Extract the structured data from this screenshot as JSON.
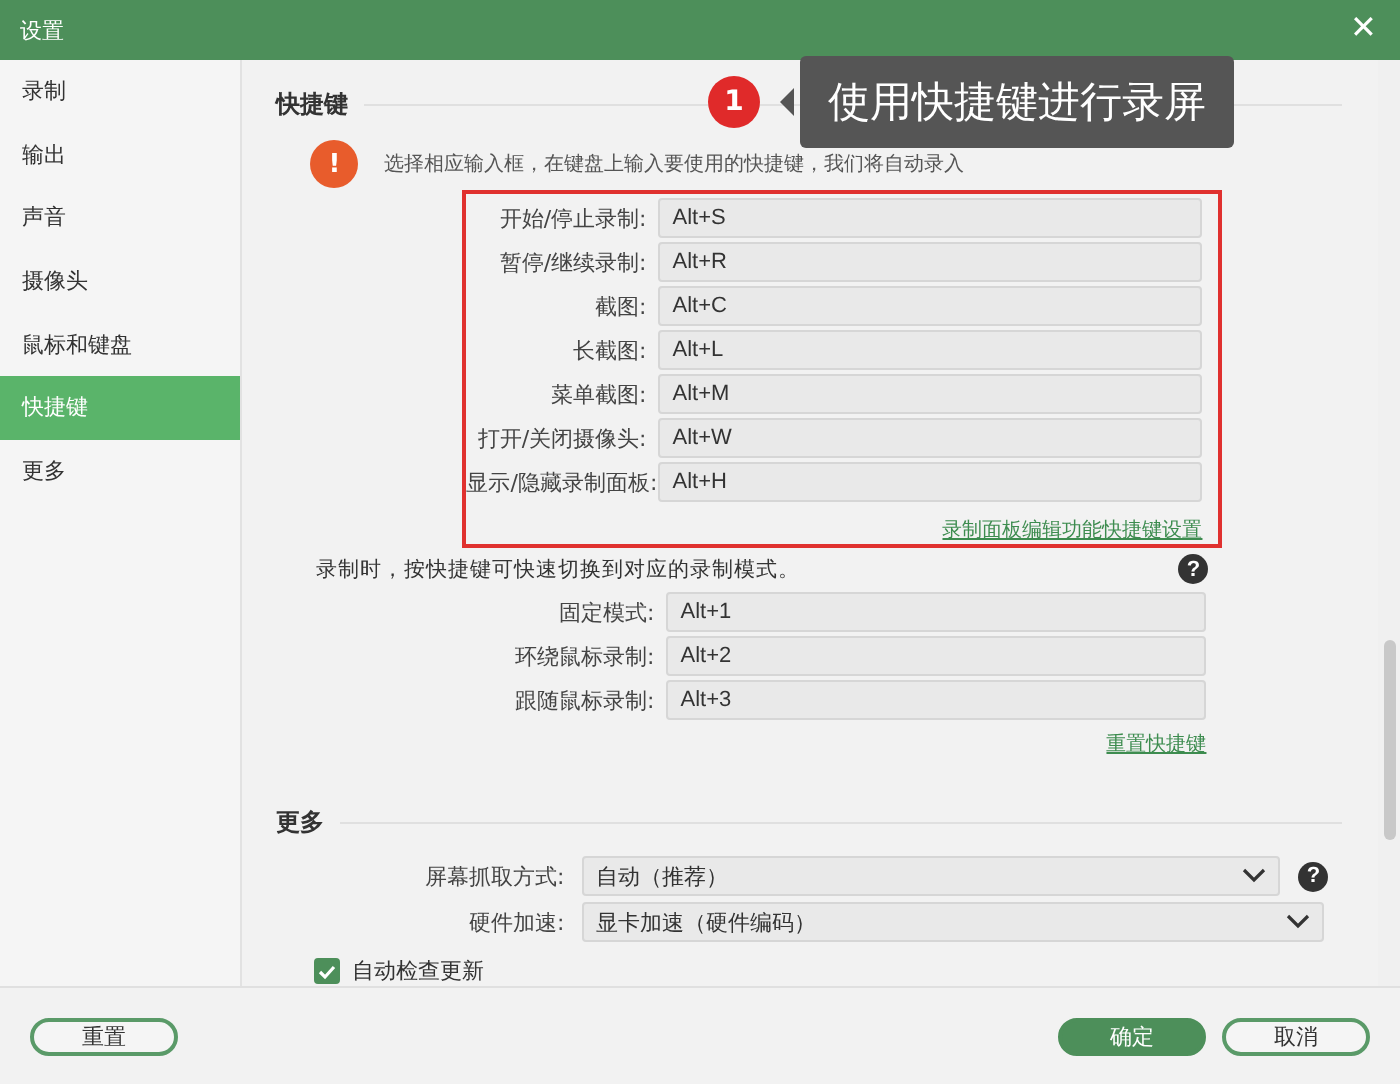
{
  "window": {
    "title": "设置",
    "close": "✕"
  },
  "sidebar": {
    "items": [
      {
        "label": "录制",
        "selected": false
      },
      {
        "label": "输出",
        "selected": false
      },
      {
        "label": "声音",
        "selected": false
      },
      {
        "label": "摄像头",
        "selected": false
      },
      {
        "label": "鼠标和键盘",
        "selected": false
      },
      {
        "label": "快捷键",
        "selected": true
      },
      {
        "label": "更多",
        "selected": false
      }
    ]
  },
  "callout": {
    "number": "1",
    "text": "使用快捷键进行录屏"
  },
  "shortcuts": {
    "heading": "快捷键",
    "notice_icon": "!",
    "notice": "选择相应输入框，在键盘上输入要使用的快捷键，我们将自动录入",
    "rows": [
      {
        "label": "开始/停止录制:",
        "value": "Alt+S"
      },
      {
        "label": "暂停/继续录制:",
        "value": "Alt+R"
      },
      {
        "label": "截图:",
        "value": "Alt+C"
      },
      {
        "label": "长截图:",
        "value": "Alt+L"
      },
      {
        "label": "菜单截图:",
        "value": "Alt+M"
      },
      {
        "label": "打开/关闭摄像头:",
        "value": "Alt+W"
      },
      {
        "label": "显示/隐藏录制面板:",
        "value": "Alt+H"
      }
    ],
    "panel_link": "录制面板编辑功能快捷键设置",
    "mode_note": "录制时，按快捷键可快速切换到对应的录制模式。",
    "mode_help": "?",
    "mode_rows": [
      {
        "label": "固定模式:",
        "value": "Alt+1"
      },
      {
        "label": "环绕鼠标录制:",
        "value": "Alt+2"
      },
      {
        "label": "跟随鼠标录制:",
        "value": "Alt+3"
      }
    ],
    "reset_link": "重置快捷键"
  },
  "more": {
    "heading": "更多",
    "selects": [
      {
        "label": "屏幕抓取方式:",
        "value": "自动（推荐）",
        "help": true
      },
      {
        "label": "硬件加速:",
        "value": "显卡加速（硬件编码）",
        "help": false
      }
    ],
    "help_glyph": "?",
    "checkbox": {
      "label": "自动检查更新",
      "checked": true
    }
  },
  "footer": {
    "buttons": [
      {
        "label": "重置",
        "kind": "outline"
      },
      {
        "label": "确定",
        "kind": "primary"
      },
      {
        "label": "取消",
        "kind": "outline"
      }
    ]
  }
}
